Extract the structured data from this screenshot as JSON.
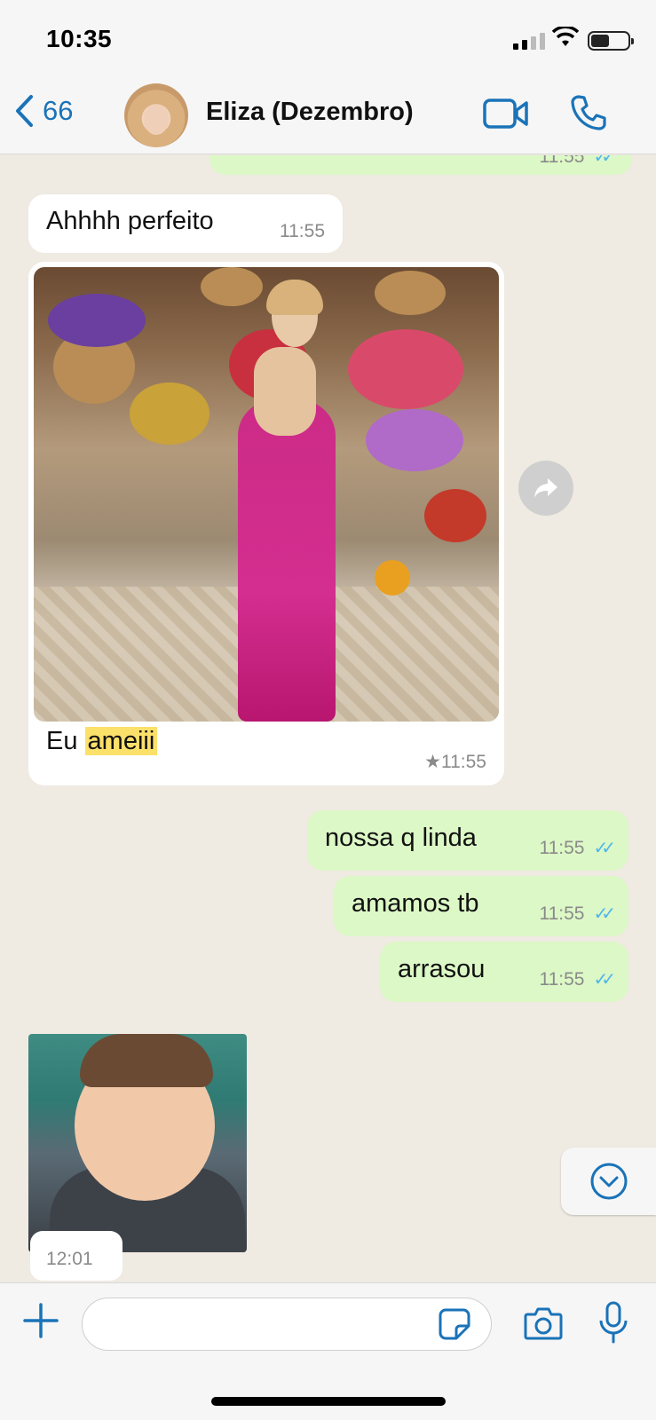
{
  "status": {
    "time": "10:35"
  },
  "header": {
    "back_count": "66",
    "contact_name": "Eliza (Dezembro)"
  },
  "messages": [
    {
      "id": "partial_top",
      "dir": "out",
      "text": "",
      "time": "11:55"
    },
    {
      "id": "m1",
      "dir": "in",
      "text": "Ahhhh perfeito",
      "time": "11:55"
    },
    {
      "id": "m2",
      "dir": "in",
      "type": "image",
      "caption_prefix": "Eu",
      "caption_highlight": "ameiii",
      "time": "★11:55"
    },
    {
      "id": "m3",
      "dir": "out",
      "text": "nossa q linda",
      "time": "11:55"
    },
    {
      "id": "m4",
      "dir": "out",
      "text": "amamos tb",
      "time": "11:55"
    },
    {
      "id": "m5",
      "dir": "out",
      "text": "arrasou",
      "time": "11:55"
    },
    {
      "id": "m6",
      "dir": "in",
      "type": "sticker",
      "time": "12:01"
    }
  ],
  "colors": {
    "accent": "#1a73b8",
    "incoming_bubble": "#ffffff",
    "outgoing_bubble": "#dcf8c6",
    "read_ticks": "#4fb6ec",
    "highlight": "#fbe06a"
  },
  "input": {
    "placeholder": ""
  }
}
